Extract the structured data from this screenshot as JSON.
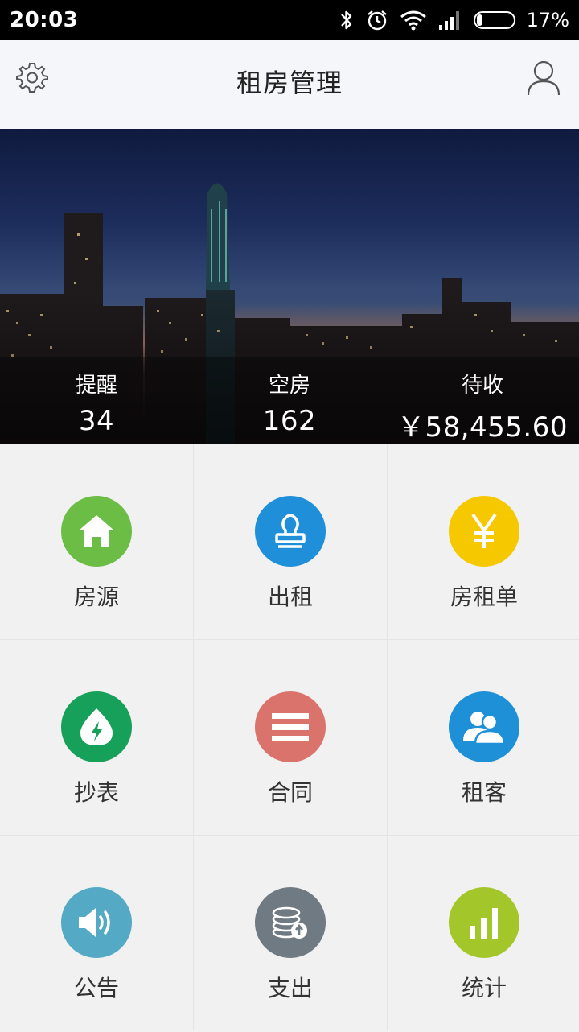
{
  "status_bar": {
    "time": "20:03",
    "battery_percent": "17%",
    "battery_level": 0.17
  },
  "header": {
    "title": "租房管理",
    "settings_icon": "gear-icon",
    "profile_icon": "user-icon"
  },
  "stats": [
    {
      "label": "提醒",
      "value": "34"
    },
    {
      "label": "空房",
      "value": "162"
    },
    {
      "label": "待收",
      "value": "￥58,455.60"
    }
  ],
  "menu": [
    {
      "label": "房源",
      "icon": "house-icon",
      "color": "#6cbd45"
    },
    {
      "label": "出租",
      "icon": "stamp-icon",
      "color": "#1e8fd8"
    },
    {
      "label": "房租单",
      "icon": "yen-icon",
      "color": "#f5c800"
    },
    {
      "label": "抄表",
      "icon": "meter-drop-icon",
      "color": "#17a05a"
    },
    {
      "label": "合同",
      "icon": "contract-lines-icon",
      "color": "#d9736b"
    },
    {
      "label": "租客",
      "icon": "tenants-icon",
      "color": "#1e90d8"
    },
    {
      "label": "公告",
      "icon": "speaker-icon",
      "color": "#54a9c4"
    },
    {
      "label": "支出",
      "icon": "coins-icon",
      "color": "#6f7a82"
    },
    {
      "label": "统计",
      "icon": "bar-stats-icon",
      "color": "#a3c72a"
    }
  ]
}
